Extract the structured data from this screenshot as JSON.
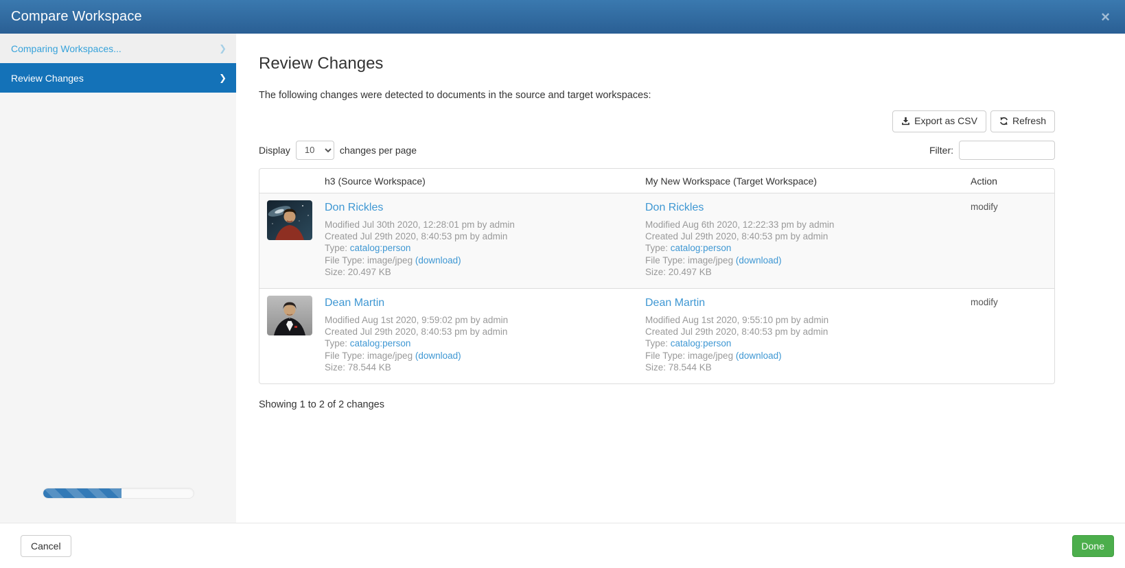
{
  "modal": {
    "title": "Compare Workspace"
  },
  "icons": {
    "close": "×",
    "chevron_right": "❯",
    "download_icon": "download-icon",
    "refresh_icon": "refresh-icon"
  },
  "colors": {
    "header_top": "#3a79af",
    "header_bottom": "#2a5f94",
    "active_nav_blue": "#1472b8",
    "link_blue": "#3e97d3",
    "done_green": "#4cae4c",
    "progress_fill_blue": "#337ab7",
    "row_stripe": "#f9f9f9"
  },
  "sidebar": {
    "items": [
      {
        "label": "Comparing Workspaces..."
      },
      {
        "label": "Review Changes"
      }
    ],
    "progress_percent": 52
  },
  "main": {
    "heading": "Review Changes",
    "description": "The following changes were detected to documents in the source and target workspaces:",
    "toolbar": {
      "export_label": "Export as CSV",
      "refresh_label": "Refresh"
    },
    "display": {
      "prefix": "Display",
      "page_size": "10",
      "suffix": "changes per page"
    },
    "filter": {
      "label": "Filter:",
      "value": "",
      "placeholder": ""
    },
    "table": {
      "columns": {
        "source": "h3 (Source Workspace)",
        "target": "My New Workspace (Target Workspace)",
        "action": "Action"
      },
      "rows": [
        {
          "action": "modify",
          "thumbnail": "portrait of man in red sweater on galaxy background",
          "source": {
            "title": "Don Rickles",
            "modified": "Modified Jul 30th 2020, 12:28:01 pm by admin",
            "created": "Created Jul 29th 2020, 8:40:53 pm by admin",
            "type_label": "Type:",
            "type_link": "catalog:person",
            "filetype_label": "File Type: image/jpeg",
            "download_link": "(download)",
            "size": "Size: 20.497 KB"
          },
          "target": {
            "title": "Don Rickles",
            "modified": "Modified Aug 6th 2020, 12:22:33 pm by admin",
            "created": "Created Jul 29th 2020, 8:40:53 pm by admin",
            "type_label": "Type:",
            "type_link": "catalog:person",
            "filetype_label": "File Type: image/jpeg",
            "download_link": "(download)",
            "size": "Size: 20.497 KB"
          }
        },
        {
          "action": "modify",
          "thumbnail": "portrait of man in black tuxedo on gray background",
          "source": {
            "title": "Dean Martin",
            "modified": "Modified Aug 1st 2020, 9:59:02 pm by admin",
            "created": "Created Jul 29th 2020, 8:40:53 pm by admin",
            "type_label": "Type:",
            "type_link": "catalog:person",
            "filetype_label": "File Type: image/jpeg",
            "download_link": "(download)",
            "size": "Size: 78.544 KB"
          },
          "target": {
            "title": "Dean Martin",
            "modified": "Modified Aug 1st 2020, 9:55:10 pm by admin",
            "created": "Created Jul 29th 2020, 8:40:53 pm by admin",
            "type_label": "Type:",
            "type_link": "catalog:person",
            "filetype_label": "File Type: image/jpeg",
            "download_link": "(download)",
            "size": "Size: 78.544 KB"
          }
        }
      ]
    },
    "summary": "Showing 1 to 2 of 2 changes"
  },
  "footer": {
    "cancel_label": "Cancel",
    "done_label": "Done"
  }
}
